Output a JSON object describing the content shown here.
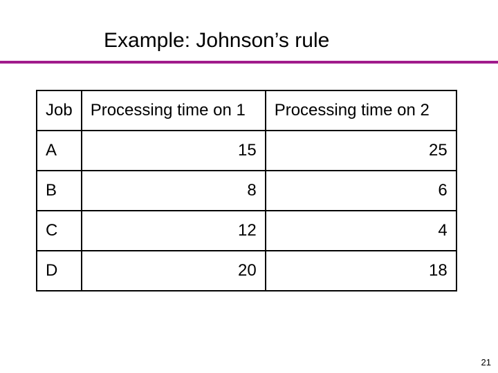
{
  "title": "Example: Johnson’s rule",
  "page_number": "21",
  "table": {
    "headers": {
      "job": "Job",
      "p1": "Processing time on 1",
      "p2": "Processing time on 2"
    },
    "rows": [
      {
        "job": "A",
        "p1": "15",
        "p2": "25"
      },
      {
        "job": "B",
        "p1": "8",
        "p2": "6"
      },
      {
        "job": "C",
        "p1": "12",
        "p2": "4"
      },
      {
        "job": "D",
        "p1": "20",
        "p2": "18"
      }
    ]
  },
  "chart_data": {
    "type": "table",
    "title": "Example: Johnson’s rule",
    "columns": [
      "Job",
      "Processing time on 1",
      "Processing time on 2"
    ],
    "rows": [
      [
        "A",
        15,
        25
      ],
      [
        "B",
        8,
        6
      ],
      [
        "C",
        12,
        4
      ],
      [
        "D",
        20,
        18
      ]
    ]
  }
}
